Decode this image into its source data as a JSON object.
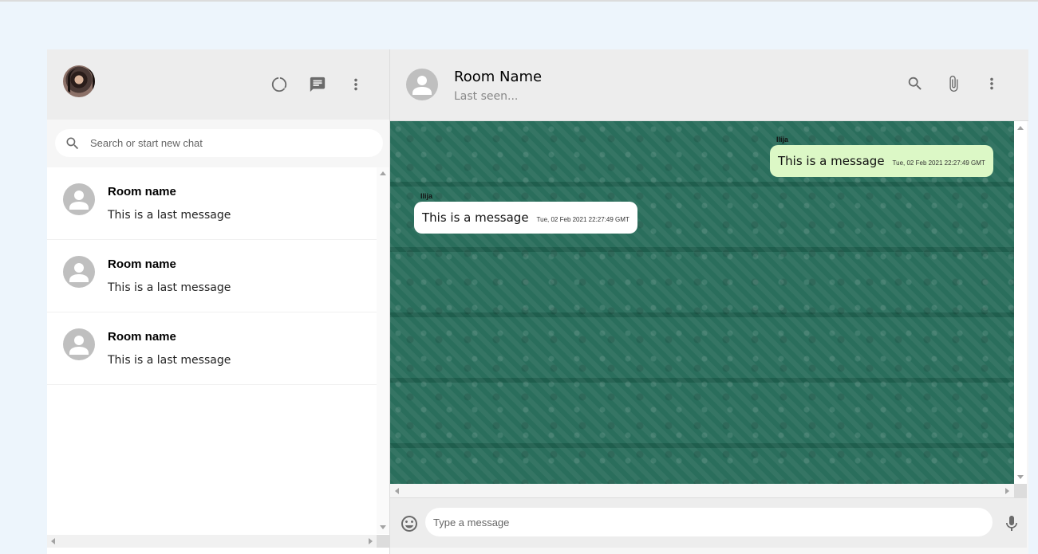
{
  "sidebar": {
    "search": {
      "placeholder": "Search or start new chat"
    },
    "icons": [
      "status-icon",
      "new-chat-icon",
      "more-vert-icon"
    ],
    "chats": [
      {
        "name": "Room name",
        "last_message": "This is a last message"
      },
      {
        "name": "Room name",
        "last_message": "This is a last message"
      },
      {
        "name": "Room name",
        "last_message": "This is a last message"
      }
    ]
  },
  "chat": {
    "room_name": "Room Name",
    "last_seen": "Last seen...",
    "icons": [
      "search-icon",
      "attach-icon",
      "more-vert-icon"
    ],
    "messages": [
      {
        "sender": "Ilija",
        "text": "This is a message",
        "time": "Tue, 02 Feb 2021 22:27:49 GMT",
        "type": "sent"
      },
      {
        "sender": "Ilija",
        "text": "This is a message",
        "time": "Tue, 02 Feb 2021 22:27:49 GMT",
        "type": "received"
      }
    ],
    "footer": {
      "placeholder": "Type a message"
    }
  },
  "colors": {
    "header_bg": "#ededed",
    "chat_bg": "#2a6e5c",
    "sent_bubble": "#dcf8c6",
    "received_bubble": "#ffffff",
    "icon": "#6b6b6b"
  }
}
